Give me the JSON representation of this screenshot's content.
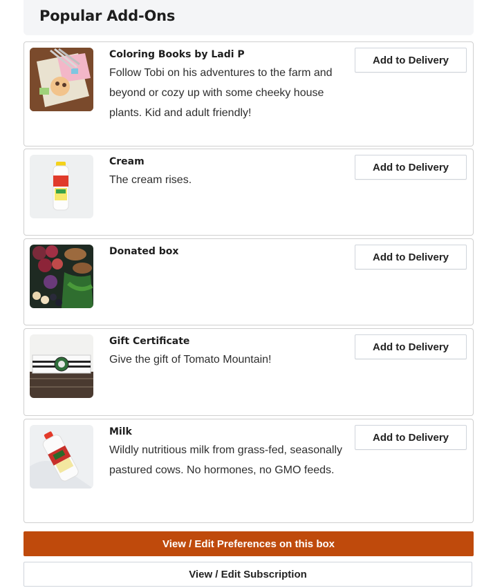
{
  "header": {
    "title": "Popular Add-Ons"
  },
  "addons": [
    {
      "title": "Coloring Books by Ladi P",
      "description": "Follow Tobi on his adventures to the farm and beyond or cozy up with some cheeky house plants. Kid and adult friendly!",
      "button_label": "Add to Delivery"
    },
    {
      "title": "Cream",
      "description": "The cream rises.",
      "button_label": "Add to Delivery"
    },
    {
      "title": "Donated box",
      "description": "",
      "button_label": "Add to Delivery"
    },
    {
      "title": "Gift Certificate",
      "description": "Give the gift of Tomato Mountain!",
      "button_label": "Add to Delivery"
    },
    {
      "title": "Milk",
      "description": "Wildly nutritious milk from grass-fed, seasonally pastured cows. No hormones, no GMO feeds.",
      "button_label": "Add to Delivery"
    }
  ],
  "actions": {
    "edit_preferences_label": "View / Edit Preferences on this box",
    "edit_subscription_label": "View / Edit Subscription"
  },
  "colors": {
    "primary": "#bf4a0c",
    "header_bg": "#f4f5f7",
    "border": "#cfcfcf"
  }
}
